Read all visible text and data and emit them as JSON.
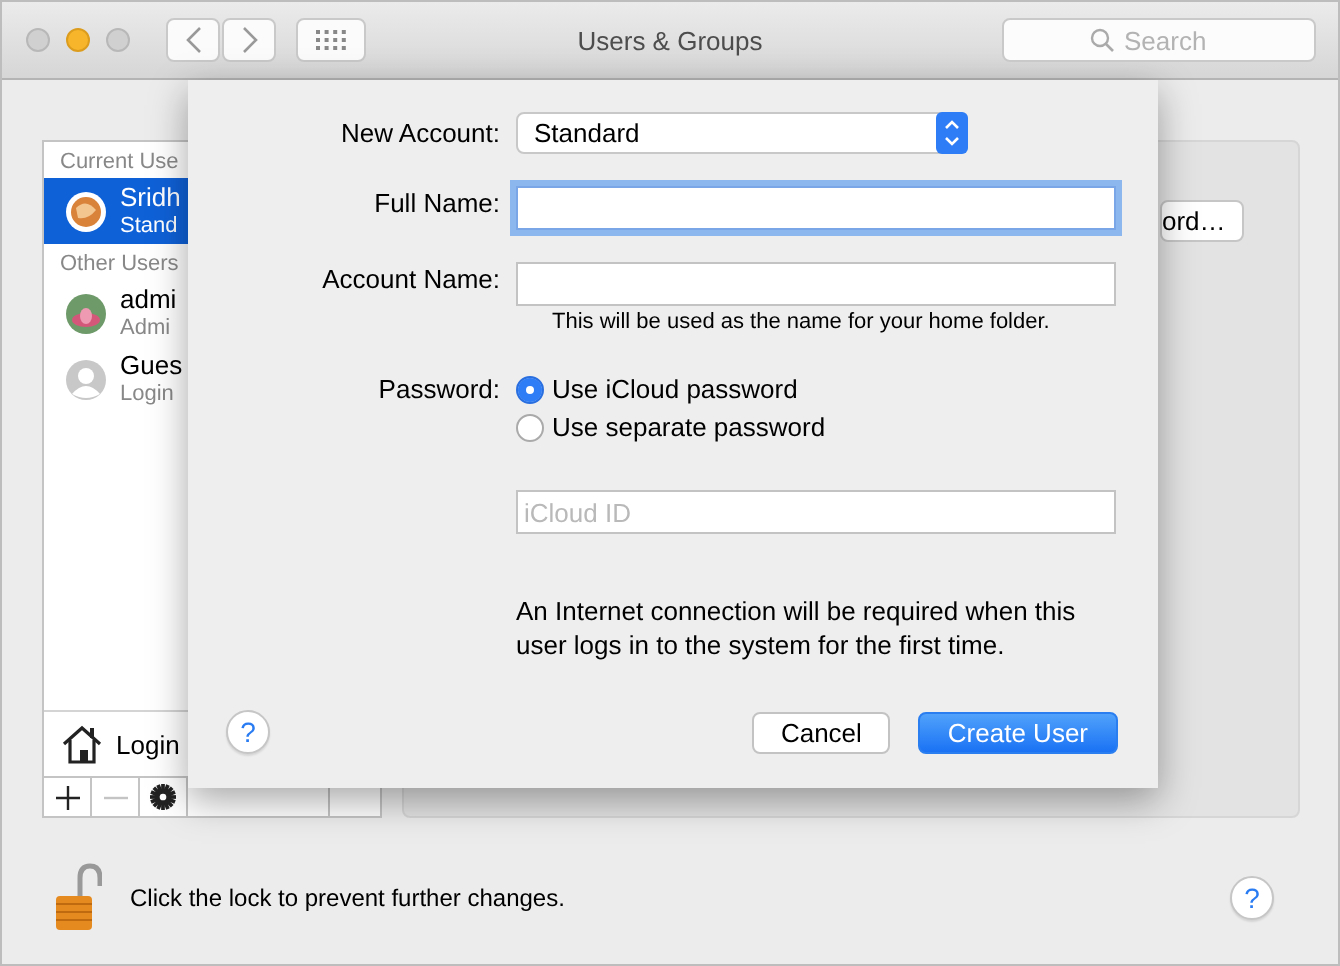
{
  "window": {
    "title": "Users & Groups",
    "search_placeholder": "Search"
  },
  "sidebar": {
    "sections": [
      {
        "header": "Current Use",
        "users": [
          {
            "name": "Sridh",
            "role": "Stand",
            "selected": true,
            "kind": "photo"
          }
        ]
      },
      {
        "header": "Other Users",
        "users": [
          {
            "name": "admi",
            "role": "Admi",
            "selected": false,
            "kind": "flower"
          },
          {
            "name": "Gues",
            "role": "Login",
            "selected": false,
            "kind": "silhouette"
          }
        ]
      }
    ],
    "login_options": "Login",
    "toolbar": [
      {
        "kind": "add",
        "disabled": false
      },
      {
        "kind": "remove",
        "disabled": true
      },
      {
        "kind": "gear",
        "disabled": false
      }
    ]
  },
  "panel": {
    "button": "ord…"
  },
  "sheet": {
    "new_account": {
      "label": "New Account:",
      "value": "Standard"
    },
    "full_name": {
      "label": "Full Name:",
      "focused": true
    },
    "account_name": {
      "label": "Account Name:",
      "hint": "This will be used as the name for your home folder."
    },
    "password": {
      "label": "Password:",
      "options": [
        {
          "label": "Use iCloud password",
          "selected": true
        },
        {
          "label": "Use separate password",
          "selected": false
        }
      ]
    },
    "icloud_id": {
      "placeholder": "iCloud ID"
    },
    "note": "An Internet connection will be required when this user logs in to the system for the first time.",
    "help": "?",
    "buttons": [
      {
        "label": "Cancel",
        "kind": "secondary"
      },
      {
        "label": "Create User",
        "kind": "default"
      }
    ]
  },
  "footer": {
    "locked": false,
    "text": "Click the lock to prevent further changes.",
    "help": "?"
  }
}
